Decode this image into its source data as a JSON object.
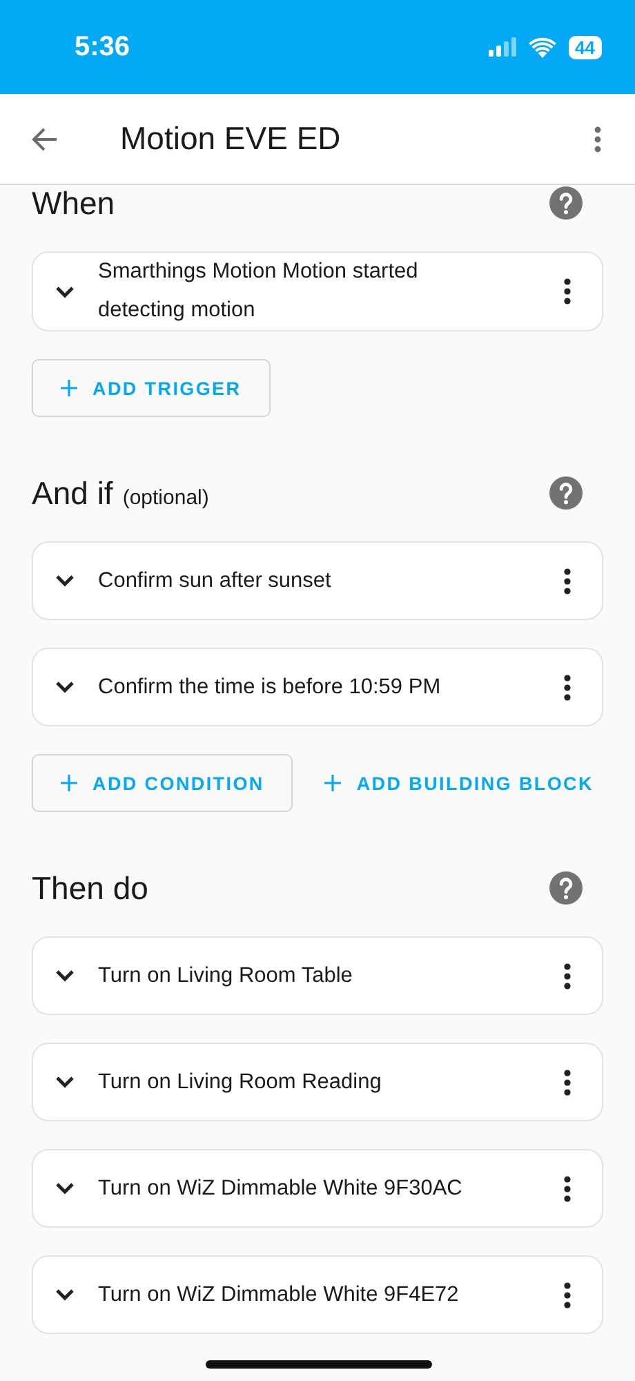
{
  "status_bar": {
    "time": "5:36",
    "battery": "44"
  },
  "app_bar": {
    "title": "Motion EVE ED"
  },
  "sections": [
    {
      "title": "When",
      "items": [
        "Smarthings Motion Motion started detecting motion"
      ],
      "buttons": [
        {
          "label": "ADD TRIGGER",
          "kind": "outlined"
        }
      ]
    },
    {
      "title": "And if",
      "subtitle": "(optional)",
      "items": [
        "Confirm sun after sunset",
        "Confirm the time is before 10:59 PM"
      ],
      "buttons": [
        {
          "label": "ADD CONDITION",
          "kind": "outlined"
        },
        {
          "label": "ADD BUILDING BLOCK",
          "kind": "text"
        }
      ]
    },
    {
      "title": "Then do",
      "items": [
        "Turn on Living Room Table",
        "Turn on Living Room Reading",
        "Turn on WiZ Dimmable White 9F30AC",
        "Turn on WiZ Dimmable White 9F4E72"
      ]
    }
  ]
}
